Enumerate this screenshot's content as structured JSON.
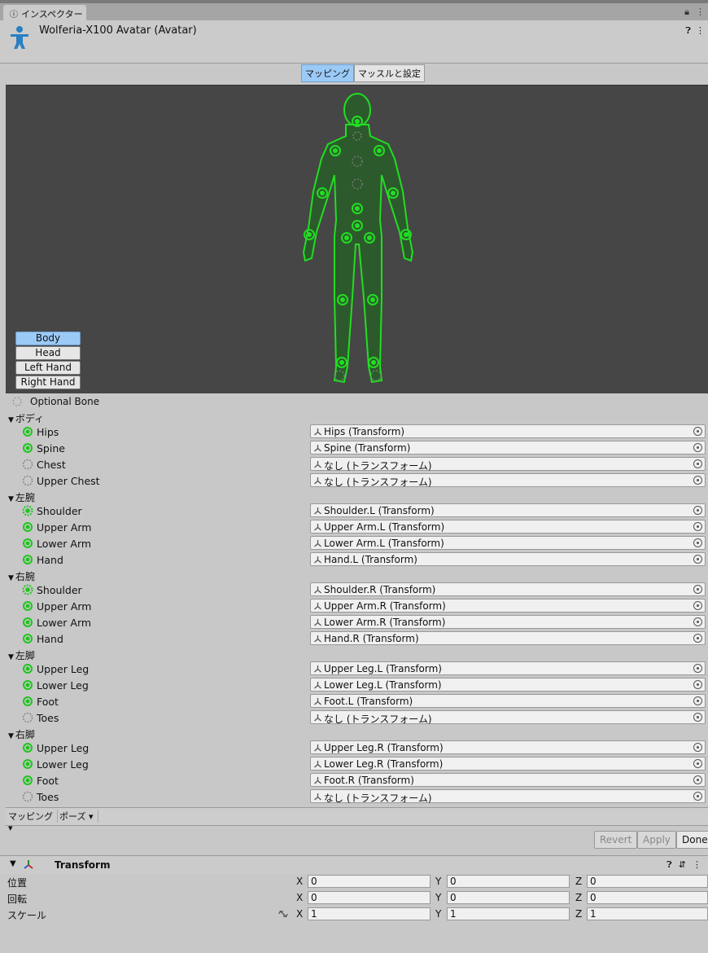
{
  "tab": {
    "title": "インスペクター"
  },
  "header": {
    "title": "Wolferia-X100 Avatar (Avatar)"
  },
  "segments": [
    {
      "label": "マッピング",
      "active": true
    },
    {
      "label": "マッスルと設定",
      "active": false
    }
  ],
  "view_buttons": [
    "Body",
    "Head",
    "Left Hand",
    "Right Hand"
  ],
  "optional_label": "Optional Bone",
  "groups": [
    {
      "name": "ボディ",
      "bones": [
        {
          "label": "Hips",
          "value": "Hips (Transform)",
          "state": "required"
        },
        {
          "label": "Spine",
          "value": "Spine (Transform)",
          "state": "required"
        },
        {
          "label": "Chest",
          "value": "なし (トランスフォーム)",
          "state": "optional-empty"
        },
        {
          "label": "Upper Chest",
          "value": "なし (トランスフォーム)",
          "state": "optional-empty"
        }
      ]
    },
    {
      "name": "左腕",
      "bones": [
        {
          "label": "Shoulder",
          "value": "Shoulder.L (Transform)",
          "state": "optional-set"
        },
        {
          "label": "Upper Arm",
          "value": "Upper Arm.L (Transform)",
          "state": "required"
        },
        {
          "label": "Lower Arm",
          "value": "Lower Arm.L (Transform)",
          "state": "required"
        },
        {
          "label": "Hand",
          "value": "Hand.L (Transform)",
          "state": "required"
        }
      ]
    },
    {
      "name": "右腕",
      "bones": [
        {
          "label": "Shoulder",
          "value": "Shoulder.R (Transform)",
          "state": "optional-set"
        },
        {
          "label": "Upper Arm",
          "value": "Upper Arm.R (Transform)",
          "state": "required"
        },
        {
          "label": "Lower Arm",
          "value": "Lower Arm.R (Transform)",
          "state": "required"
        },
        {
          "label": "Hand",
          "value": "Hand.R (Transform)",
          "state": "required"
        }
      ]
    },
    {
      "name": "左脚",
      "bones": [
        {
          "label": "Upper Leg",
          "value": "Upper Leg.L (Transform)",
          "state": "required"
        },
        {
          "label": "Lower Leg",
          "value": "Lower Leg.L (Transform)",
          "state": "required"
        },
        {
          "label": "Foot",
          "value": "Foot.L (Transform)",
          "state": "required"
        },
        {
          "label": "Toes",
          "value": "なし (トランスフォーム)",
          "state": "optional-empty"
        }
      ]
    },
    {
      "name": "右脚",
      "bones": [
        {
          "label": "Upper Leg",
          "value": "Upper Leg.R (Transform)",
          "state": "required"
        },
        {
          "label": "Lower Leg",
          "value": "Lower Leg.R (Transform)",
          "state": "required"
        },
        {
          "label": "Foot",
          "value": "Foot.R (Transform)",
          "state": "required"
        },
        {
          "label": "Toes",
          "value": "なし (トランスフォーム)",
          "state": "optional-empty"
        }
      ]
    }
  ],
  "bottom_menus": [
    "マッピング",
    "ポーズ"
  ],
  "actions": {
    "revert": "Revert",
    "apply": "Apply",
    "done": "Done"
  },
  "transform": {
    "title": "Transform",
    "rows": [
      {
        "label": "位置",
        "x": "0",
        "y": "0",
        "z": "0"
      },
      {
        "label": "回転",
        "x": "0",
        "y": "0",
        "z": "0"
      },
      {
        "label": "スケール",
        "x": "1",
        "y": "1",
        "z": "1"
      }
    ],
    "axes": [
      "X",
      "Y",
      "Z"
    ]
  },
  "colors": {
    "accent": "#9ccaf7",
    "bone_green": "#1ec41e",
    "viewport": "#464646"
  }
}
